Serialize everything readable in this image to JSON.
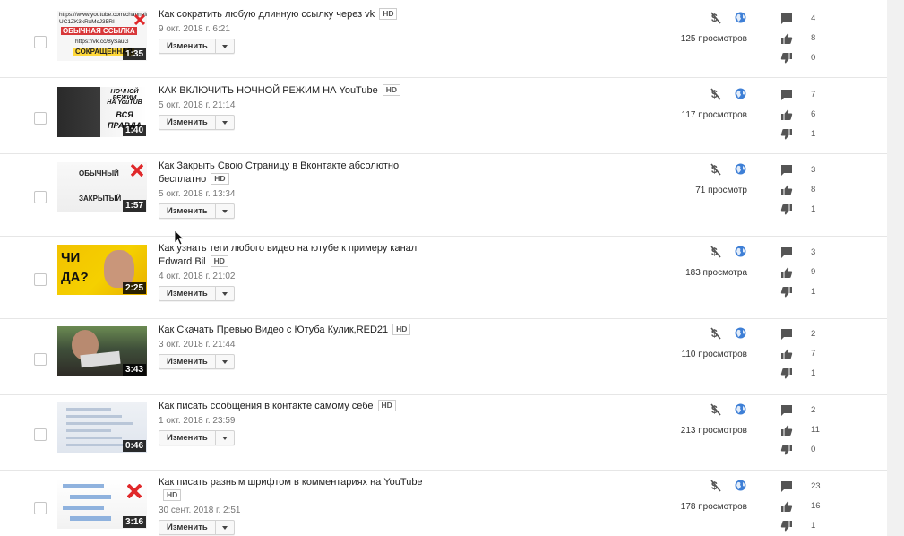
{
  "videos": [
    {
      "title": "Как сократить любую длинную ссылку через vk",
      "hd": "HD",
      "date": "9 окт. 2018 г. 6:21",
      "edit": "Изменить",
      "duration": "1:35",
      "views": "125 просмотров",
      "comments": "4",
      "likes": "8",
      "dislikes": "0",
      "thumb_text": [
        "https://www.youtube.com/channel/",
        "UC1ZK3kRxMcJ35RI",
        "ОБЫЧНАЯ ССЫЛКА",
        "https://vk.cc/8ySauG",
        "СОКРАЩЕННАЯ"
      ]
    },
    {
      "title": "КАК ВКЛЮЧИТЬ НОЧНОЙ РЕЖИМ НА YouTube",
      "hd": "HD",
      "date": "5 окт. 2018 г. 21:14",
      "edit": "Изменить",
      "duration": "1:40",
      "views": "117 просмотров",
      "comments": "7",
      "likes": "6",
      "dislikes": "1",
      "thumb_text": [
        "НОЧНОЙ РЕЖИМ",
        "НА YouTUB",
        "ВСЯ",
        "ПРАВДА"
      ]
    },
    {
      "title": "Как Закрыть Свою Страницу в Вконтакте абсолютно бесплатно",
      "hd": "HD",
      "date": "5 окт. 2018 г. 13:34",
      "edit": "Изменить",
      "duration": "1:57",
      "views": "71 просмотр",
      "comments": "3",
      "likes": "8",
      "dislikes": "1",
      "thumb_text": [
        "ОБЫЧНЫЙ",
        "ЗАКРЫТЫЙ"
      ]
    },
    {
      "title": "Как узнать теги любого видео на ютубе к примеру канал Edward Bil",
      "hd": "HD",
      "date": "4 окт. 2018 г. 21:02",
      "edit": "Изменить",
      "duration": "2:25",
      "views": "183 просмотра",
      "comments": "3",
      "likes": "9",
      "dislikes": "1",
      "thumb_text": [
        "ЧИ",
        "ДА?"
      ]
    },
    {
      "title": "Как Скачать Превью Видео с Ютуба Кулик,RED21",
      "hd": "HD",
      "date": "3 окт. 2018 г. 21:44",
      "edit": "Изменить",
      "duration": "3:43",
      "views": "110 просмотров",
      "comments": "2",
      "likes": "7",
      "dislikes": "1",
      "thumb_text": []
    },
    {
      "title": "Как писать сообщения в контакте самому себе",
      "hd": "HD",
      "date": "1 окт. 2018 г. 23:59",
      "edit": "Изменить",
      "duration": "0:46",
      "views": "213 просмотров",
      "comments": "2",
      "likes": "11",
      "dislikes": "0",
      "thumb_text": []
    },
    {
      "title": "Как писать разным шрифтом в комментариях на YouTube",
      "hd": "HD",
      "date": "30 сент. 2018 г. 2:51",
      "edit": "Изменить",
      "duration": "3:16",
      "views": "178 просмотров",
      "comments": "23",
      "likes": "16",
      "dislikes": "1",
      "thumb_text": []
    }
  ],
  "colors": {
    "globe": "#3e7fd6",
    "icon": "#555555",
    "red_x": "#e0282a"
  }
}
